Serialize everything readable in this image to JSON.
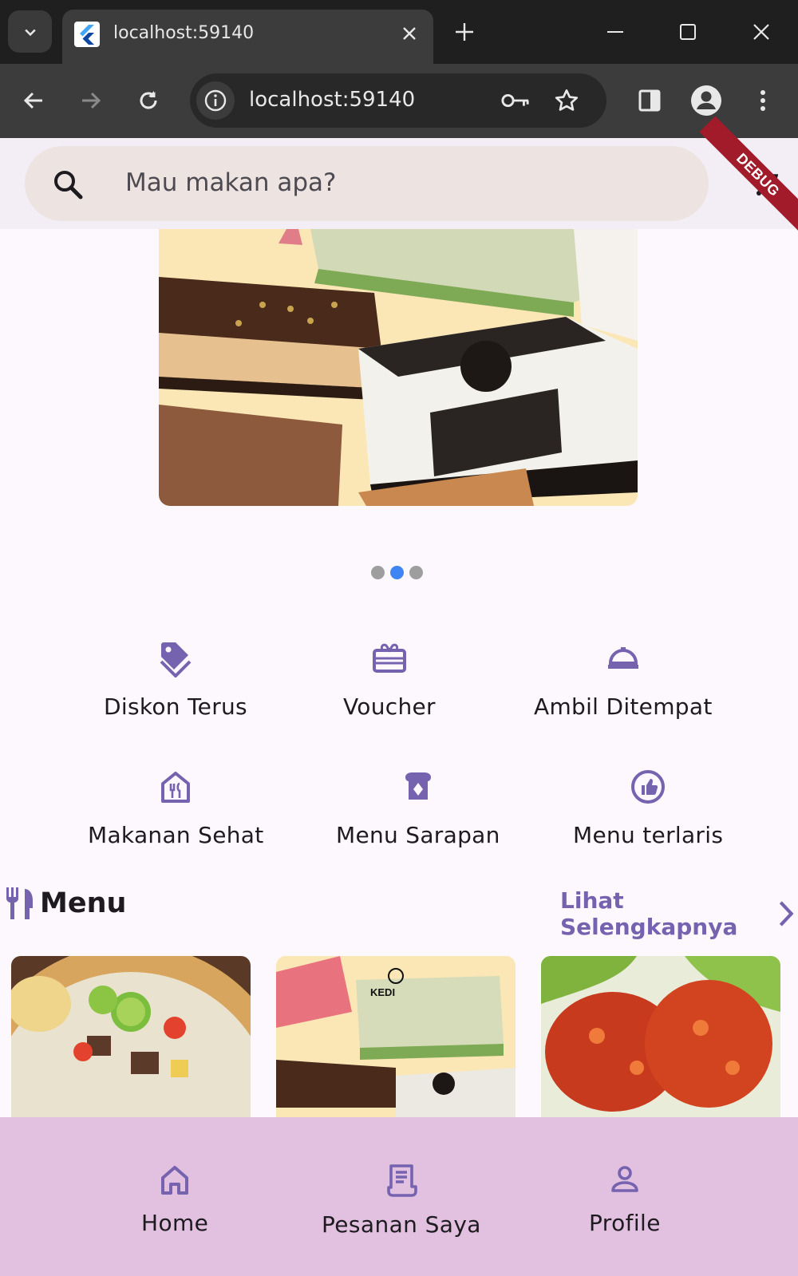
{
  "browser": {
    "tab_title": "localhost:59140",
    "url": "localhost:59140"
  },
  "search": {
    "placeholder": "Mau makan apa?"
  },
  "debug_banner": "DEBUG",
  "carousel": {
    "page_count": 3,
    "active_index": 1
  },
  "categories": [
    {
      "label": "Diskon Terus",
      "icon": "tag-icon"
    },
    {
      "label": "Voucher",
      "icon": "gift-card-icon"
    },
    {
      "label": "Ambil Ditempat",
      "icon": "room-service-icon"
    },
    {
      "label": "Makanan Sehat",
      "icon": "restaurant-house-icon"
    },
    {
      "label": "Menu Sarapan",
      "icon": "breakfast-icon"
    },
    {
      "label": "Menu terlaris",
      "icon": "thumb-up-icon"
    }
  ],
  "menu_section": {
    "title": "Menu",
    "see_more": "Lihat Selengkapnya"
  },
  "bottom_nav": [
    {
      "label": "Home",
      "icon": "home-icon"
    },
    {
      "label": "Pesanan Saya",
      "icon": "receipt-icon"
    },
    {
      "label": "Profile",
      "icon": "person-icon"
    }
  ],
  "colors": {
    "accent": "#7563b0",
    "header_bg": "#f3eef6",
    "nav_bg": "#e2c0df",
    "indicator_active": "#3f86f4"
  }
}
